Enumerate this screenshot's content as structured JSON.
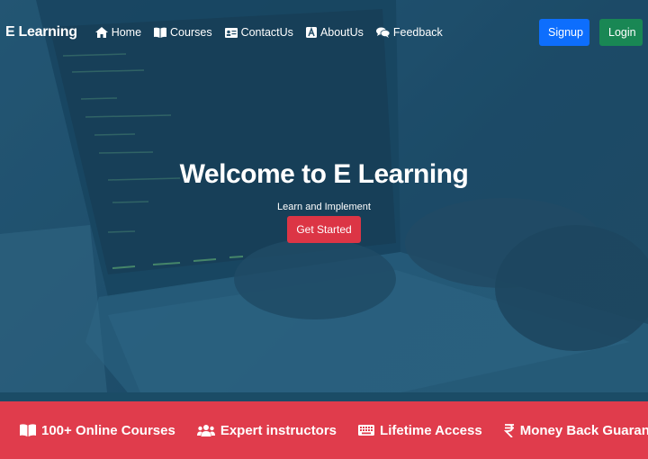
{
  "brand": "E Learning",
  "nav": {
    "links": [
      {
        "label": "Home",
        "icon": "home-icon"
      },
      {
        "label": "Courses",
        "icon": "book-icon"
      },
      {
        "label": "ContactUs",
        "icon": "id-card-icon"
      },
      {
        "label": "AboutUs",
        "icon": "letter-a-icon"
      },
      {
        "label": "Feedback",
        "icon": "comments-icon"
      }
    ],
    "signup_label": "Signup",
    "login_label": "Login"
  },
  "hero": {
    "title": "Welcome to E Learning",
    "subtitle": "Learn and Implement",
    "cta_label": "Get Started"
  },
  "features": [
    {
      "label": "100+ Online Courses",
      "icon": "book-open-icon"
    },
    {
      "label": "Expert instructors",
      "icon": "users-icon"
    },
    {
      "label": "Lifetime Access",
      "icon": "keyboard-icon"
    },
    {
      "label": "Money Back Guarantee*",
      "icon": "rupee-icon"
    }
  ],
  "colors": {
    "signup": "#0d6efd",
    "login": "#198754",
    "cta": "#dc3545",
    "features_bar": "#e03c4c",
    "hero_tint": "#1f4e6a"
  }
}
